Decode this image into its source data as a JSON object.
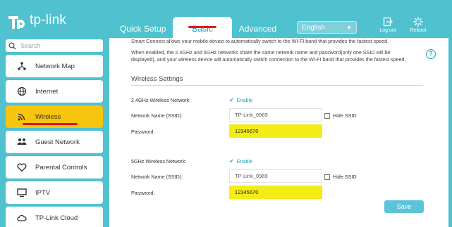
{
  "brand": {
    "name": "tp-link"
  },
  "header": {
    "tabs": [
      {
        "label": "Quick Setup"
      },
      {
        "label": "Basic"
      },
      {
        "label": "Advanced"
      }
    ],
    "language": "English",
    "logout_label": "Log out",
    "reboot_label": "Reboot"
  },
  "sidebar": {
    "search_placeholder": "Search",
    "items": [
      {
        "label": "Network Map",
        "icon": "network-map-icon"
      },
      {
        "label": "Internet",
        "icon": "globe-icon"
      },
      {
        "label": "Wireless",
        "icon": "wifi-icon",
        "active": true
      },
      {
        "label": "Guest Network",
        "icon": "guest-network-icon"
      },
      {
        "label": "Parental Controls",
        "icon": "heart-icon"
      },
      {
        "label": "IPTV",
        "icon": "monitor-icon"
      },
      {
        "label": "TP-Link Cloud",
        "icon": "cloud-icon"
      }
    ]
  },
  "main": {
    "intro_line1": "Smart Connect allows your mobile device to automatically switch to the WI-FI band that provides the fastest speed.",
    "intro_line2": "When enabled, the 2.4GHz and 5GHz networks share the same network name and password(only one SSID will be",
    "intro_line3": "displayed), and your wireless device will automatically switch connection to the WI-FI band that provides the fastest speed.",
    "section_title": "Wireless Settings",
    "band24": {
      "label": "2.4GHz Wireless Network:",
      "enable_label": "Enable",
      "ssid_label": "Network Name (SSID):",
      "ssid_value": "TP-Link_0969",
      "hide_ssid_label": "Hide SSID",
      "password_label": "Password:",
      "password_value": "12345670"
    },
    "band5": {
      "label": "5GHz Wireless Network:",
      "enable_label": "Enable",
      "ssid_label": "Network Name (SSID):",
      "ssid_value": "TP-Link_0969",
      "hide_ssid_label": "Hide SSID",
      "password_label": "Password:",
      "password_value": "12345670"
    },
    "save_label": "Save"
  }
}
